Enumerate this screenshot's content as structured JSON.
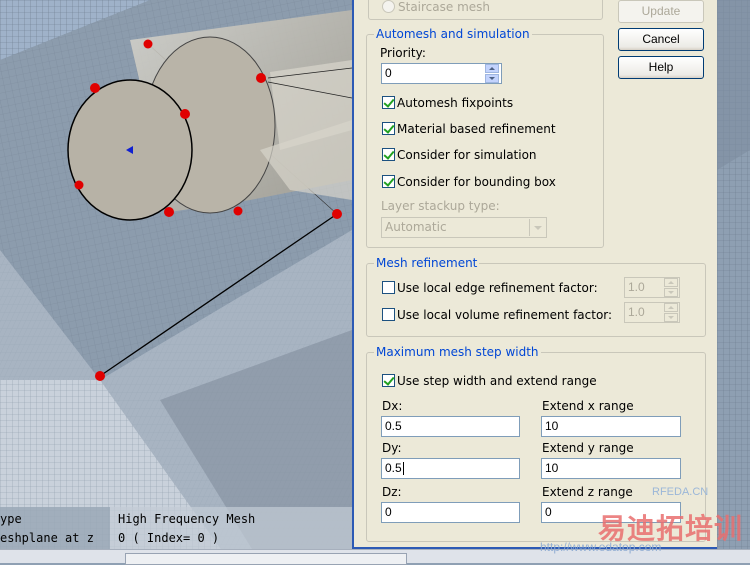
{
  "viewport": {
    "info_rows": [
      {
        "label": "ype",
        "value": "High Frequency Mesh"
      },
      {
        "label": "eshplane at z",
        "value": "0 ( Index= 0 )"
      }
    ]
  },
  "dialog": {
    "staircase_label": "Staircase mesh",
    "buttons": {
      "update": "Update",
      "cancel": "Cancel",
      "help": "Help"
    },
    "automesh": {
      "title": "Automesh and simulation",
      "priority_label": "Priority:",
      "priority_value": "0",
      "checks": [
        {
          "label": "Automesh fixpoints",
          "checked": true
        },
        {
          "label": "Material based refinement",
          "checked": true
        },
        {
          "label": "Consider for simulation",
          "checked": true
        },
        {
          "label": "Consider for bounding box",
          "checked": true
        }
      ],
      "layer_stackup_label": "Layer stackup type:",
      "layer_stackup_value": "Automatic"
    },
    "refinement": {
      "title": "Mesh refinement",
      "edge_label": "Use local edge refinement factor:",
      "edge_value": "1.0",
      "volume_label": "Use local volume refinement factor:",
      "volume_value": "1.0"
    },
    "step_width": {
      "title": "Maximum mesh step width",
      "use_label": "Use step width and extend range",
      "dx_label": "Dx:",
      "dx_value": "0.5",
      "dy_label": "Dy:",
      "dy_value": "0.5",
      "dz_label": "Dz:",
      "dz_value": "0",
      "ext_x_label": "Extend x range",
      "ext_x_value": "10",
      "ext_y_label": "Extend y range",
      "ext_y_value": "10",
      "ext_z_label": "Extend z range",
      "ext_z_value": "0"
    }
  },
  "watermark": {
    "site": "RFEDA.CN",
    "brand": "易迪拓培训",
    "url": "http://www.edatop.com"
  },
  "colors": {
    "group_title": "#0046d5",
    "dialog_bg": "#ece9d8",
    "point_red": "#e00000"
  }
}
